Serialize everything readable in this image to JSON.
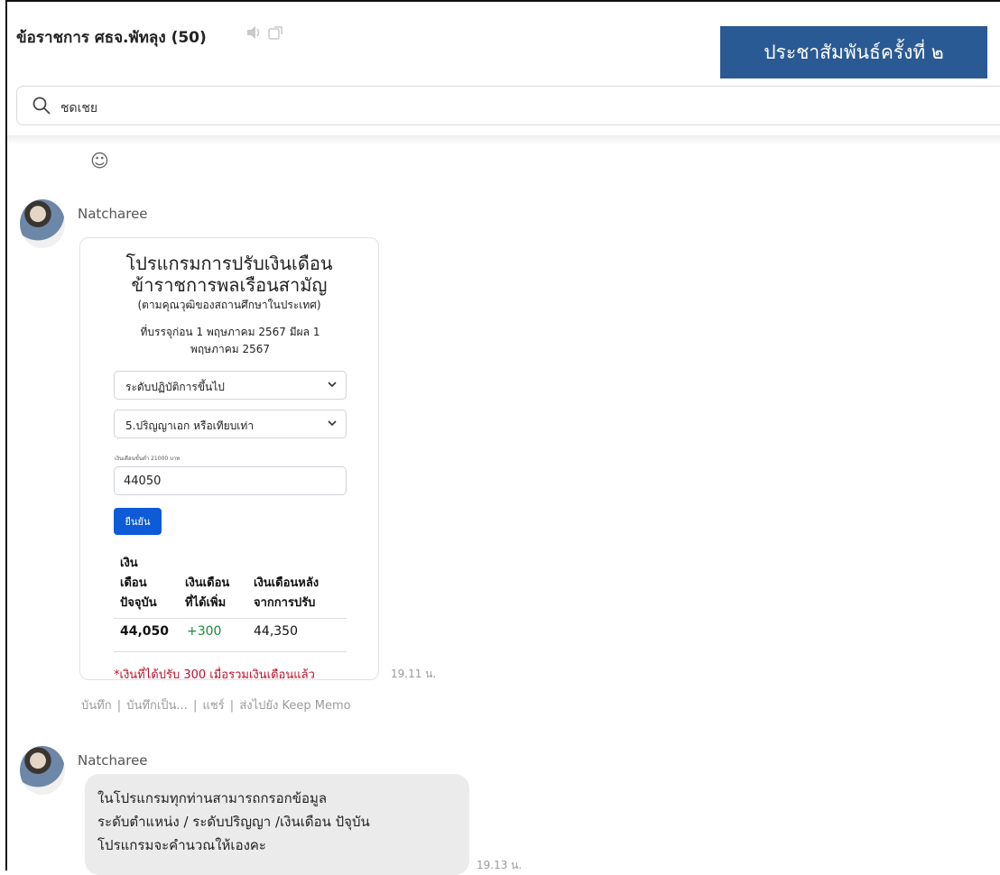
{
  "header": {
    "title": "ข้อราชการ ศธจ.พัทลุง (50)",
    "mute_icon": "speaker-icon",
    "external_icon": "open-external-icon",
    "announcement": "ประชาสัมพันธ์ครั้งที่ ๒"
  },
  "search": {
    "icon": "search-icon",
    "value": "ชดเชย"
  },
  "reaction": {
    "icon": "emoji-face-icon",
    "glyph": "☺"
  },
  "messages": [
    {
      "sender": "Natcharee",
      "time": "19.11 น.",
      "card": {
        "title_line1": "โปรแกรมการปรับเงินเดือน",
        "title_line2": "ข้าราชการพลเรือนสามัญ",
        "subtitle": "(ตามคุณวุฒิของสถานศึกษาในประเทศ)",
        "condition_line1": "ที่บรรจุก่อน 1 พฤษภาคม 2567 มีผล 1",
        "condition_line2": "พฤษภาคม 2567",
        "select_level": "ระดับปฏิบัติการขึ้นไป",
        "select_degree": "5.ปริญญาเอก หรือเทียบเท่า",
        "input_label": "เงินเดือนขั้นต่ำ 21000 บาท",
        "input_value": "44050",
        "confirm_label": "ยืนยัน",
        "col1_line1": "เงิน",
        "col1_line2": "เดือน",
        "col1_line3": "ปัจจุบัน",
        "col2_line1": "เงินเดือน",
        "col2_line2": "ที่ได้เพิ่ม",
        "col3_line1": "เงินเดือนหลัง",
        "col3_line2": "จากการปรับ",
        "current_salary": "44,050",
        "increase": "+300",
        "new_salary": "44,350",
        "note": "*เงินที่ได้ปรับ 300 เมื่อรวมเงินเดือนแล้ว"
      },
      "actions": [
        "บันทึก",
        "บันทึกเป็น...",
        "แชร์",
        "ส่งไปยัง Keep Memo"
      ]
    },
    {
      "sender": "Natcharee",
      "time": "19.13 น.",
      "lines": [
        "ในโปรแกรมทุกท่านสามารถกรอกข้อมูล",
        "ระดับตำแหน่ง / ระดับปริญญา /เงินเดือน ปัจุบัน",
        "โปรแกรมจะคำนวณให้เองคะ"
      ]
    }
  ],
  "colors": {
    "announcement_bg": "#2a5a94",
    "confirm_bg": "#0d5bd7",
    "increase_text": "#1a8a3a",
    "note_text": "#c0102a",
    "bubble_bg": "#ebebeb"
  }
}
